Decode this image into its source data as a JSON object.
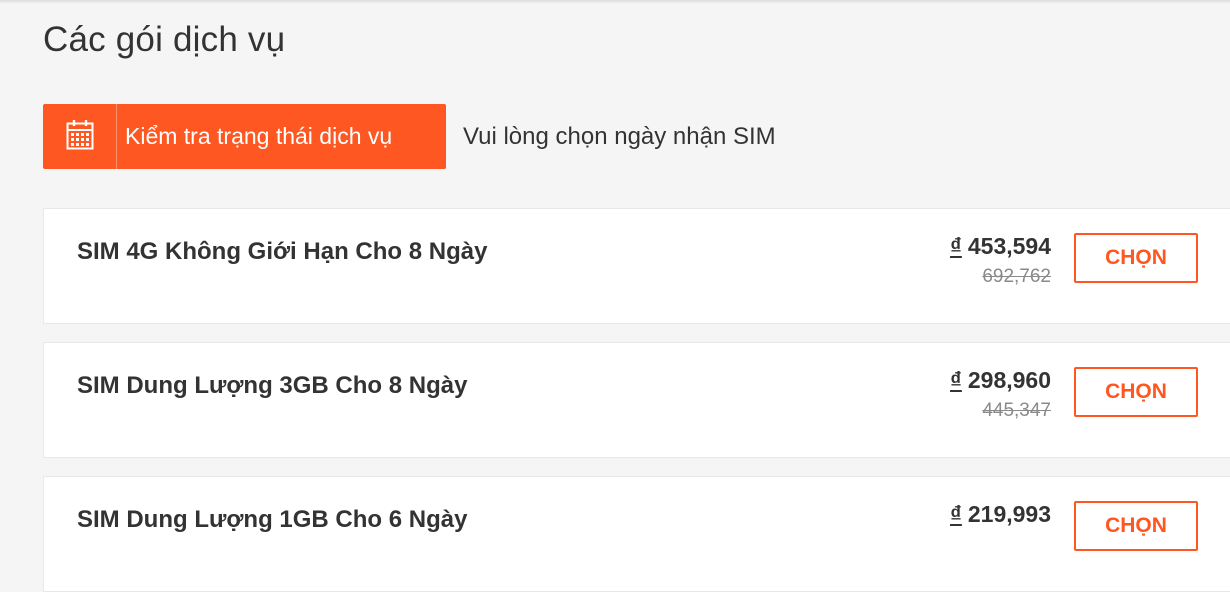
{
  "page_title": "Các gói dịch vụ",
  "status_button": {
    "label": "Kiểm tra trạng thái dịch vụ",
    "icon": "calendar-icon"
  },
  "date_hint": "Vui lòng chọn ngày nhận SIM",
  "accent_color": "#fe5722",
  "packages": [
    {
      "name": "SIM 4G Không Giới Hạn Cho 8 Ngày",
      "currency": "₫",
      "price": "453,594",
      "old_price": "692,762",
      "button": "CHỌN"
    },
    {
      "name": "SIM Dung Lượng 3GB Cho 8 Ngày",
      "currency": "₫",
      "price": "298,960",
      "old_price": "445,347",
      "button": "CHỌN"
    },
    {
      "name": "SIM Dung Lượng 1GB Cho 6 Ngày",
      "currency": "₫",
      "price": "219,993",
      "old_price": "",
      "button": "CHỌN"
    }
  ]
}
